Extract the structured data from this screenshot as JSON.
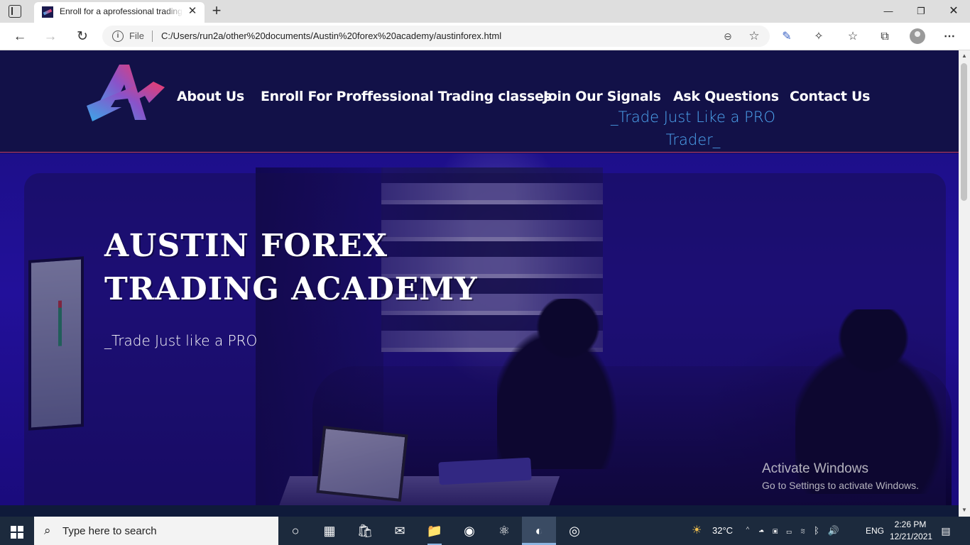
{
  "browser": {
    "tab": {
      "title": "Enroll for a aprofessional trading",
      "close_glyph": "✕"
    },
    "new_tab_glyph": "+",
    "window_controls": {
      "minimize": "—",
      "maximize": "❐",
      "close": "✕"
    },
    "nav": {
      "back": "←",
      "forward": "→",
      "reload": "↻"
    },
    "address": {
      "scheme_label": "File",
      "url": "C:/Users/run2a/other%20documents/Austin%20forex%20academy/austinforex.html"
    },
    "toolbar": {
      "pen": "✎",
      "extensions": "✧",
      "favorites": "☆",
      "collections": "⧉",
      "more": "⋯"
    }
  },
  "site": {
    "nav": {
      "about": "About Us",
      "enroll": "Enroll For Proffessional Trading classes",
      "signals": "Join Our Signals",
      "ask": "Ask Questions",
      "contact": "Contact Us"
    },
    "tagline_line1": "_Trade Just Like a PRO",
    "tagline_line2": "Trader_",
    "hero": {
      "title_line1": "AUSTIN FOREX",
      "title_line2": "TRADING ACADEMY",
      "subtitle": "_Trade Just like a PRO"
    },
    "colors": {
      "header_bg": "#121148",
      "accent_blue": "#4ea7f2",
      "accent_pink": "#ee3b6b"
    }
  },
  "watermark": {
    "title": "Activate Windows",
    "subtitle": "Go to Settings to activate Windows."
  },
  "taskbar": {
    "search_placeholder": "Type here to search",
    "apps": [
      {
        "name": "task-view-icon",
        "glyph": "○"
      },
      {
        "name": "widgets-icon",
        "glyph": "▦"
      },
      {
        "name": "store-icon",
        "glyph": "🛍"
      },
      {
        "name": "mail-icon",
        "glyph": "✉"
      },
      {
        "name": "file-explorer-icon",
        "glyph": "📁"
      },
      {
        "name": "chrome-icon",
        "glyph": "◉"
      },
      {
        "name": "atom-icon",
        "glyph": "⚛"
      },
      {
        "name": "edge-icon",
        "glyph": "◐"
      },
      {
        "name": "media-icon",
        "glyph": "◎"
      }
    ],
    "weather": {
      "temp": "32°C",
      "icon": "☀"
    },
    "tray_icons": "⌃ ☁ ▣ ▭ ≋ ᛒ 🔊",
    "language": "ENG",
    "time": "2:26 PM",
    "date": "12/21/2021"
  }
}
